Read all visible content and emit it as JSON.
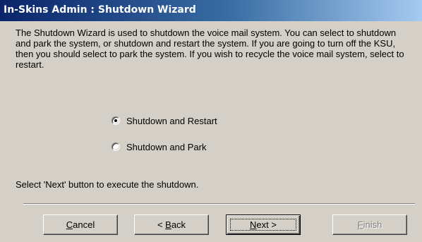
{
  "window": {
    "title": "In-Skins Admin : Shutdown Wizard"
  },
  "description": "The Shutdown Wizard is used to shutdown the voice mail system. You can select to shutdown and park the system, or shutdown and restart the system. If you are going to turn off the KSU, then you should select to park the system. If you wish to recycle the voice mail system, select to restart.",
  "options": [
    {
      "label": "Shutdown and Restart",
      "selected": true
    },
    {
      "label": "Shutdown and Park",
      "selected": false
    }
  ],
  "instruction": "Select 'Next' button to execute the shutdown.",
  "buttons": {
    "cancel": {
      "mnemonic": "C",
      "rest": "ancel"
    },
    "back": {
      "prefix": "< ",
      "mnemonic": "B",
      "rest": "ack"
    },
    "next": {
      "mnemonic": "N",
      "rest": "ext >"
    },
    "finish": {
      "mnemonic": "F",
      "rest": "inish",
      "enabled": false
    }
  }
}
